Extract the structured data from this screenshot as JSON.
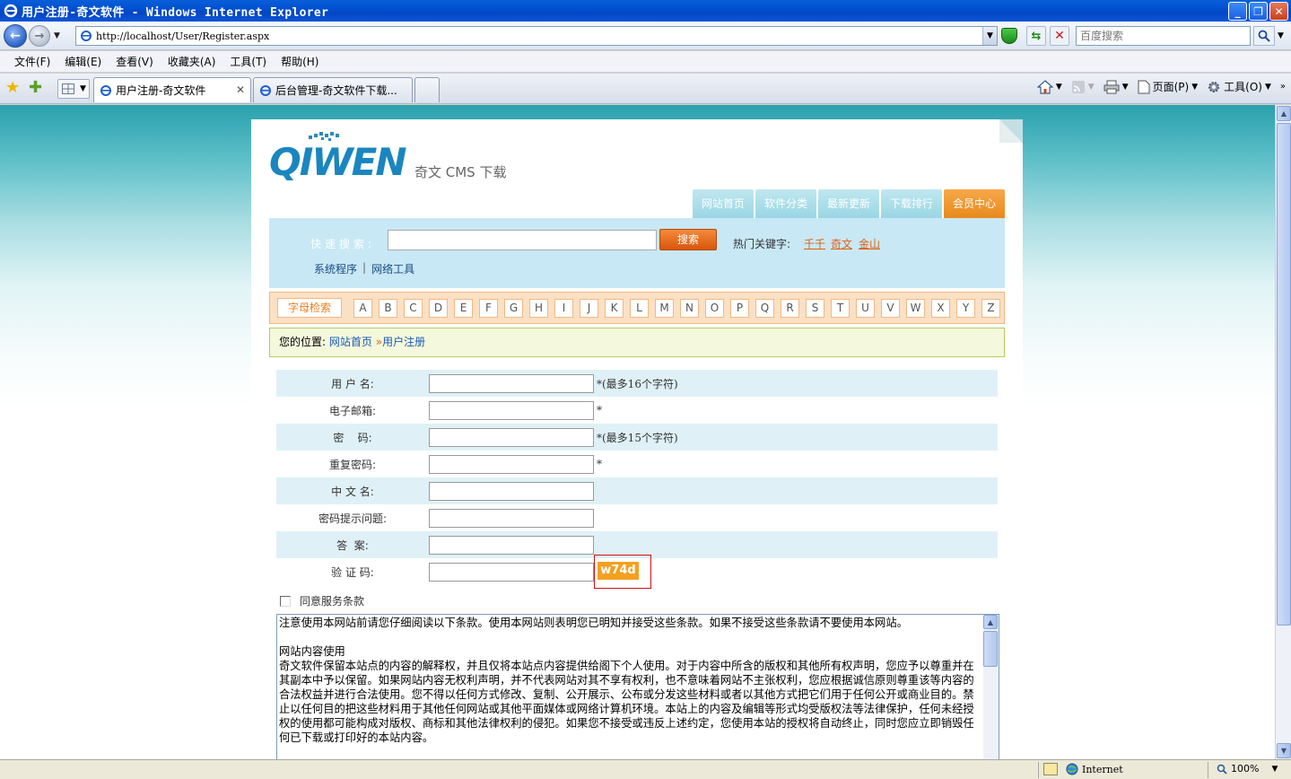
{
  "window": {
    "title": "用户注册-奇文软件 - Windows Internet Explorer"
  },
  "address": {
    "url": "http://localhost/User/Register.aspx",
    "search_placeholder": "百度搜索"
  },
  "menu": [
    "文件(F)",
    "编辑(E)",
    "查看(V)",
    "收藏夹(A)",
    "工具(T)",
    "帮助(H)"
  ],
  "tabs": [
    {
      "label": "用户注册-奇文软件",
      "active": true
    },
    {
      "label": "后台管理-奇文软件下载...",
      "active": false
    }
  ],
  "command_bar": {
    "page_label": "页面(P)",
    "tools_label": "工具(O)"
  },
  "site": {
    "logo_text": "QIWEN",
    "logo_sub": "奇文 CMS 下载",
    "nav": [
      {
        "label": "网站首页",
        "active": false
      },
      {
        "label": "软件分类",
        "active": false
      },
      {
        "label": "最新更新",
        "active": false
      },
      {
        "label": "下载排行",
        "active": false
      },
      {
        "label": "会员中心",
        "active": true
      }
    ],
    "quick_search_label": "快速搜索:",
    "search_button": "搜索",
    "hot_label": "热门关键字:",
    "hot_keywords": [
      "千千",
      "奇文",
      "金山"
    ],
    "categories": [
      "系统程序",
      "网络工具"
    ],
    "alpha_title": "字母检索",
    "letters": [
      "A",
      "B",
      "C",
      "D",
      "E",
      "F",
      "G",
      "H",
      "I",
      "J",
      "K",
      "L",
      "M",
      "N",
      "O",
      "P",
      "Q",
      "R",
      "S",
      "T",
      "U",
      "V",
      "W",
      "X",
      "Y",
      "Z"
    ],
    "breadcrumb": {
      "prefix": "您的位置:",
      "home": "网站首页",
      "arrow": "»",
      "current": "用户注册"
    }
  },
  "form": {
    "fields": [
      {
        "label": "用 户 名:",
        "note": "*(最多16个字符)"
      },
      {
        "label": "电子邮箱:",
        "note": "*"
      },
      {
        "label": "密    码:",
        "note": "*(最多15个字符)"
      },
      {
        "label": "重复密码:",
        "note": "*"
      },
      {
        "label": "中 文 名:",
        "note": ""
      },
      {
        "label": "密码提示问题:",
        "note": ""
      },
      {
        "label": "答  案:",
        "note": ""
      },
      {
        "label": "验 证 码:",
        "note": ""
      }
    ],
    "captcha": "w74d",
    "agree_label": "同意服务条款",
    "terms": "注意使用本网站前请您仔细阅读以下条款。使用本网站则表明您已明知并接受这些条款。如果不接受这些条款请不要使用本网站。\n\n网站内容使用\n奇文软件保留本站点的内容的解释权，并且仅将本站点内容提供给阁下个人使用。对于内容中所含的版权和其他所有权声明，您应予以尊重并在其副本中予以保留。如果网站内容无权利声明，并不代表网站对其不享有权利，也不意味着网站不主张权利，您应根据诚信原则尊重该等内容的合法权益并进行合法使用。您不得以任何方式修改、复制、公开展示、公布或分发这些材料或者以其他方式把它们用于任何公开或商业目的。禁止以任何目的把这些材料用于其他任何网站或其他平面媒体或网络计算机环境。本站上的内容及编辑等形式均受版权法等法律保护，任何未经授权的使用都可能构成对版权、商标和其他法律权利的侵犯。如果您不接受或违反上述约定，您使用本站的授权将自动终止，同时您应立即销毁任何已下载或打印好的本站内容。"
  },
  "status": {
    "zone": "Internet",
    "zoom": "100%"
  }
}
